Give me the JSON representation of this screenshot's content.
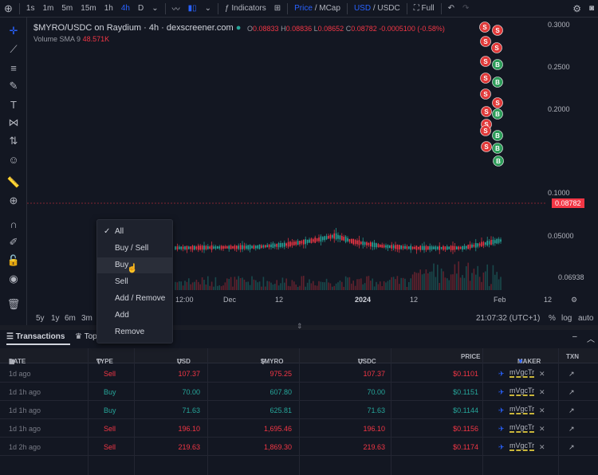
{
  "toolbar": {
    "intervals": [
      "1s",
      "1m",
      "5m",
      "15m",
      "1h",
      "4h",
      "D"
    ],
    "active_interval": "4h",
    "indicators_label": "Indicators",
    "price_label": "Price",
    "mcap_label": "MCap",
    "usd_label": "USD",
    "usdc_label": "USDC",
    "full_label": "Full",
    "slash": "/"
  },
  "legend": {
    "title": "$MYRO/USDC on Raydium · 4h · dexscreener.com",
    "open_label": "O",
    "open": "0.08833",
    "high_label": "H",
    "high": "0.08836",
    "low_label": "L",
    "low": "0.08652",
    "close_label": "C",
    "close": "0.08782",
    "change": "-0.0005100 (-0.58%)",
    "volume_label": "Volume SMA 9",
    "volume_value": "48.571K"
  },
  "price_axis": [
    "0.3000",
    "0.2500",
    "0.2000",
    "0.1000",
    "0.05000",
    "0.06938"
  ],
  "last_price": "0.08782",
  "time_axis": [
    "12:00",
    "Dec",
    "12",
    "2024",
    "12",
    "Feb",
    "12"
  ],
  "bottom_bar": {
    "ranges": [
      "5y",
      "1y",
      "6m",
      "3m"
    ],
    "time": "21:07:32 (UTC+1)",
    "percent": "%",
    "log": "log",
    "auto": "auto"
  },
  "filter_menu": {
    "items": [
      "All",
      "Buy / Sell",
      "Buy",
      "Sell",
      "Add / Remove",
      "Add",
      "Remove"
    ],
    "checked": "All",
    "hovered": "Buy",
    "check_mark": "✓"
  },
  "tabs": {
    "transactions": "Transactions",
    "top": "Top"
  },
  "table": {
    "headers": [
      "DATE",
      "TYPE",
      "USD",
      "$MYRO",
      "USDC",
      "PRICE",
      "MAKER",
      "TXN"
    ],
    "rows": [
      {
        "date": "1d ago",
        "type": "Sell",
        "usd": "107.37",
        "myro": "975.25",
        "usdc": "107.37",
        "price": "$0.1101",
        "maker": "mVgcTr"
      },
      {
        "date": "1d 1h ago",
        "type": "Buy",
        "usd": "70.00",
        "myro": "607.80",
        "usdc": "70.00",
        "price": "$0.1151",
        "maker": "mVgcTr"
      },
      {
        "date": "1d 1h ago",
        "type": "Buy",
        "usd": "71.63",
        "myro": "625.81",
        "usdc": "71.63",
        "price": "$0.1144",
        "maker": "mVgcTr"
      },
      {
        "date": "1d 1h ago",
        "type": "Sell",
        "usd": "196.10",
        "myro": "1,695.46",
        "usdc": "196.10",
        "price": "$0.1156",
        "maker": "mVgcTr"
      },
      {
        "date": "1d 2h ago",
        "type": "Sell",
        "usd": "219.63",
        "myro": "1,869.30",
        "usdc": "219.63",
        "price": "$0.1174",
        "maker": "mVgcTr"
      }
    ]
  },
  "colors": {
    "up": "#26a69a",
    "down": "#f23645",
    "accent": "#2962ff",
    "bg": "#131722"
  },
  "markers": {
    "sell": "S",
    "buy": "B"
  }
}
